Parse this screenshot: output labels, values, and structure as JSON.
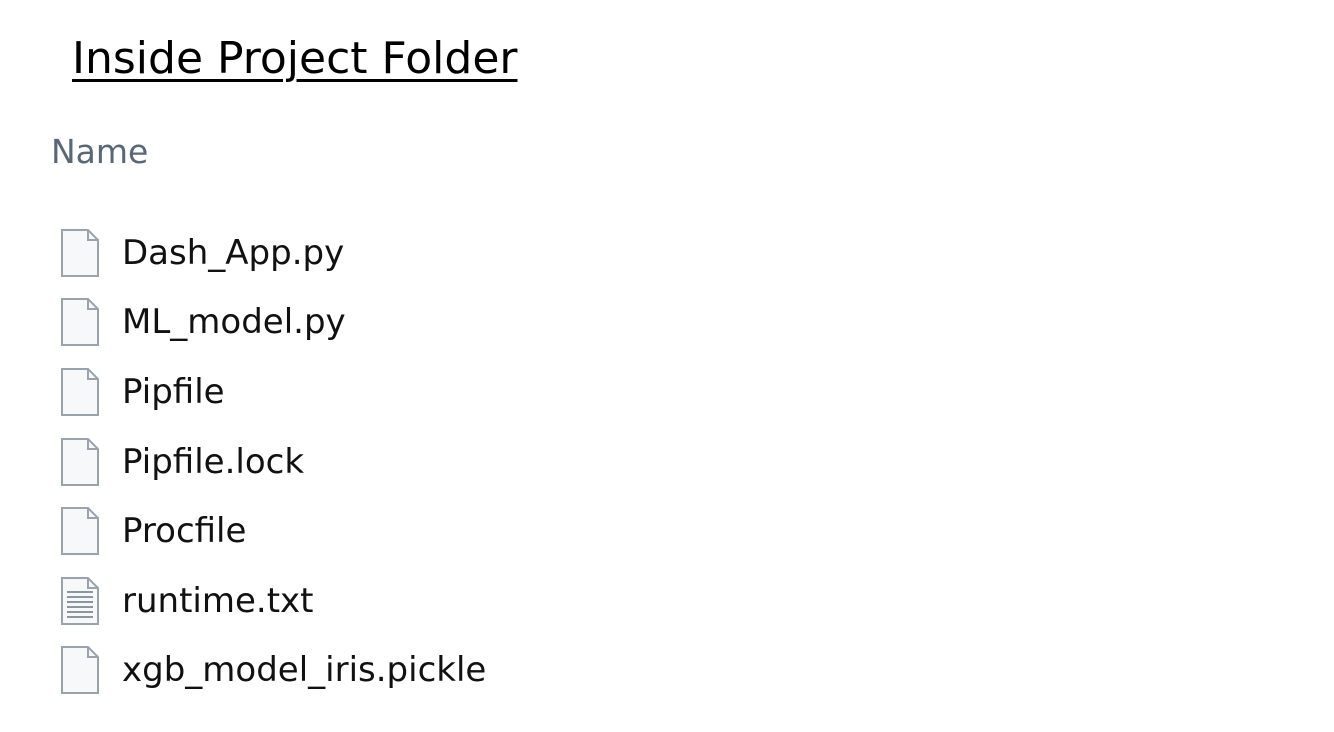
{
  "title": "Inside Project Folder",
  "column_header": "Name",
  "files": [
    {
      "name": "Dash_App.py",
      "icon": "blank-file-icon"
    },
    {
      "name": "ML_model.py",
      "icon": "blank-file-icon"
    },
    {
      "name": "Pipfile",
      "icon": "blank-file-icon"
    },
    {
      "name": "Pipfile.lock",
      "icon": "blank-file-icon"
    },
    {
      "name": "Procfile",
      "icon": "blank-file-icon"
    },
    {
      "name": "runtime.txt",
      "icon": "text-file-icon"
    },
    {
      "name": "xgb_model_iris.pickle",
      "icon": "blank-file-icon"
    }
  ],
  "colors": {
    "header_text": "#5a6778",
    "icon_outline": "#9aa3ad",
    "icon_fill": "#f7f8fa",
    "icon_lines": "#8c96a1"
  }
}
